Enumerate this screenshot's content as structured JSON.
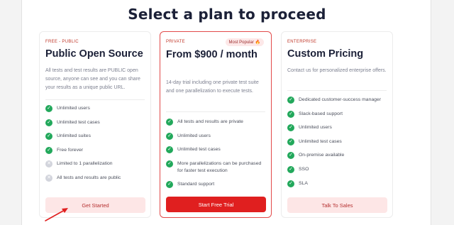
{
  "page": {
    "title": "Select a plan to proceed"
  },
  "plans": [
    {
      "tier": "FREE - PUBLIC",
      "name": "Public Open Source",
      "description": "All tests and test results are PUBLIC open source, anyone can see and you can share your results as a unique public URL.",
      "features": [
        {
          "text": "Unlimited users",
          "icon": "check-circle-icon"
        },
        {
          "text": "Unlimited test cases",
          "icon": "check-circle-icon"
        },
        {
          "text": "Unlimited suites",
          "icon": "check-circle-icon"
        },
        {
          "text": "Free forever",
          "icon": "check-circle-icon"
        },
        {
          "text": "Limited to 1 parallelization",
          "icon": "x-circle-icon"
        },
        {
          "text": "All tests and results are public",
          "icon": "x-circle-icon"
        }
      ],
      "cta": "Get Started"
    },
    {
      "tier": "PRIVATE",
      "badge": "Most Popular 🔥",
      "name": "From $900 / month",
      "description": "14-day trial including one private test suite and one parallelization to execute tests.",
      "features": [
        {
          "text": "All tests and results are private",
          "icon": "check-circle-icon"
        },
        {
          "text": "Unlimited users",
          "icon": "check-circle-icon"
        },
        {
          "text": "Unlimited test cases",
          "icon": "check-circle-icon"
        },
        {
          "text": "More parallelizations can be purchased for faster test execution",
          "icon": "check-circle-icon"
        },
        {
          "text": "Standard support",
          "icon": "check-circle-icon"
        }
      ],
      "cta": "Start Free Trial"
    },
    {
      "tier": "ENTERPRISE",
      "name": "Custom Pricing",
      "description": "Contact us for personalized enterprise offers.",
      "features": [
        {
          "text": "Dedicated customer-success manager",
          "icon": "check-circle-icon"
        },
        {
          "text": "Slack-based support",
          "icon": "check-circle-icon"
        },
        {
          "text": "Unlimited users",
          "icon": "check-circle-icon"
        },
        {
          "text": "Unlimited test cases",
          "icon": "check-circle-icon"
        },
        {
          "text": "On-premise available",
          "icon": "check-circle-icon"
        },
        {
          "text": "SSO",
          "icon": "check-circle-icon"
        },
        {
          "text": "SLA",
          "icon": "check-circle-icon"
        }
      ],
      "cta": "Talk To Sales"
    }
  ],
  "colors": {
    "accent": "#e01f1f",
    "check": "#22a85b",
    "cross": "#d2d4dc",
    "annotation_arrow": "#e01f1f"
  }
}
